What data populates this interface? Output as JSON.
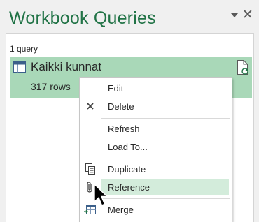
{
  "pane": {
    "title": "Workbook Queries",
    "dropdown_icon": "triangle-down-icon",
    "close_label": "✕"
  },
  "queries": {
    "count_label": "1 query",
    "items": [
      {
        "name": "Kaikki kunnat",
        "rows": "317 rows",
        "icon": "table-icon",
        "status_icon": "refresh-document-icon"
      }
    ]
  },
  "context_menu": {
    "items": [
      {
        "label": "Edit",
        "icon": ""
      },
      {
        "label": "Delete",
        "icon": "x-icon"
      },
      {
        "label": "Refresh",
        "icon": ""
      },
      {
        "label": "Load To...",
        "icon": ""
      },
      {
        "label": "Duplicate",
        "icon": "copy-icon"
      },
      {
        "label": "Reference",
        "icon": "paperclip-icon",
        "highlighted": true
      },
      {
        "label": "Merge",
        "icon": "merge-table-icon"
      }
    ]
  },
  "colors": {
    "accent": "#217346",
    "card_selected": "#a9d8b8",
    "menu_hover": "#d3ecdb"
  }
}
